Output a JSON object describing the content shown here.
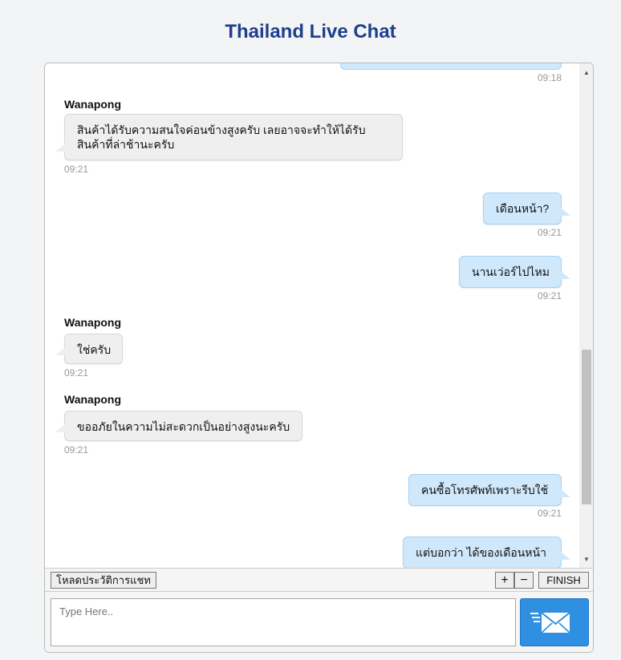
{
  "header": {
    "title": "Thailand Live Chat"
  },
  "messages": [
    {
      "time": "09:18"
    },
    {
      "sender": "Wanapong",
      "line1": "สินค้าได้รับความสนใจค่อนข้างสูงครับ เลยอาจจะทำให้ได้รับ",
      "line2": "สินค้าที่ล่าช้านะครับ",
      "time": "09:21"
    },
    {
      "text": "เดือนหน้า?",
      "time": "09:21"
    },
    {
      "text": "นานเว่อร์ไปไหม",
      "time": "09:21"
    },
    {
      "sender": "Wanapong",
      "text": "ใช่ครับ",
      "time": "09:21"
    },
    {
      "sender": "Wanapong",
      "text": "ขออภัยในความไม่สะดวกเป็นอย่างสูงนะครับ",
      "time": "09:21"
    },
    {
      "text": "คนซื้อโทรศัพท์เพราะรีบใช้",
      "time": "09:21"
    },
    {
      "text": "แต่บอกว่า ได้ของเดือนหน้า"
    }
  ],
  "toolbar": {
    "history_label": "โหลดประวัติการแชท",
    "plus_label": "+",
    "minus_label": "−",
    "finish_label": "FINISH"
  },
  "composer": {
    "placeholder": "Type Here.."
  },
  "icons": {
    "send": "send-mail-icon",
    "scroll_up": "scroll-up-icon",
    "scroll_down": "scroll-down-icon"
  },
  "colors": {
    "title": "#1d3f8c",
    "outgoing_bubble": "#cfe8fb",
    "incoming_bubble": "#efefef",
    "send_button": "#2f8fe0"
  }
}
